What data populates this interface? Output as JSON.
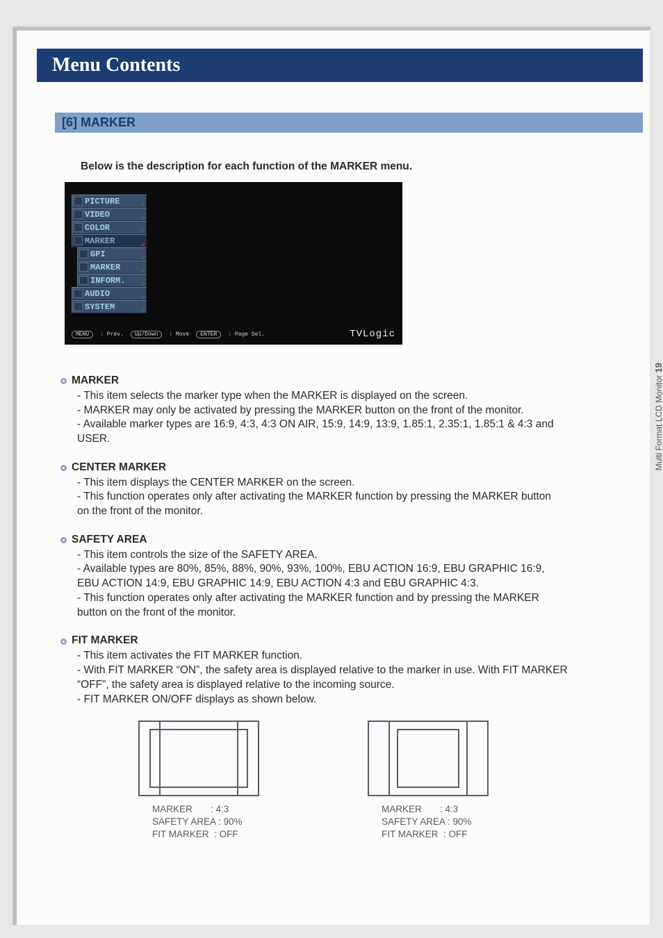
{
  "title": "Menu Contents",
  "section": "[6] MARKER",
  "intro": "Below is the description for each function of the MARKER menu.",
  "tabs": [
    "PICTURE",
    "VIDEO",
    "COLOR",
    "MARKER",
    "GPI",
    "MARKER",
    "INFORM.",
    "AUDIO",
    "SYSTEM"
  ],
  "footer": {
    "menu": "MENU",
    "menu_txt": ": Prev.",
    "updown": "Up/Down",
    "updown_txt": ": Move",
    "enter": "ENTER",
    "enter_txt": ": Page Sel.",
    "brand": "TVLogic"
  },
  "items": [
    {
      "title": "MARKER",
      "lines": [
        "- This item selects the marker type when the MARKER is displayed on the screen.",
        "- MARKER may only be activated by pressing the MARKER button on the front of the monitor.",
        "- Available marker types are 16:9, 4:3, 4:3 ON AIR, 15:9, 14:9, 13:9, 1.85:1, 2.35:1, 1.85:1 & 4:3 and\n  USER."
      ]
    },
    {
      "title": "CENTER MARKER",
      "lines": [
        "- This item displays the CENTER MARKER on the screen.",
        "- This function operates only after activating the MARKER function by pressing the MARKER button\n  on the front of the monitor."
      ]
    },
    {
      "title": "SAFETY AREA",
      "lines": [
        "- This item controls the size of the SAFETY AREA.",
        "- Available types are 80%, 85%, 88%, 90%, 93%, 100%, EBU ACTION 16:9, EBU GRAPHIC 16:9,\n  EBU ACTION 14:9, EBU GRAPHIC 14:9, EBU ACTION 4:3 and EBU GRAPHIC 4:3.",
        "- This function operates only after activating the MARKER function and by pressing the MARKER\n  button on the front of the monitor."
      ]
    },
    {
      "title": "FIT MARKER",
      "lines": [
        "- This item activates the FIT MARKER function.",
        "- With FIT MARKER “ON”, the safety area is displayed relative to the marker in use. With FIT MARKER\n “OFF”, the safety area is displayed relative to the incoming source.",
        "- FIT MARKER ON/OFF displays as shown below."
      ]
    }
  ],
  "dia1": "MARKER       : 4:3\nSAFETY AREA : 90%\nFIT MARKER  : OFF",
  "dia2": "MARKER       : 4:3\nSAFETY AREA : 90%\nFIT MARKER  : OFF",
  "side": "Multi Format LCD Monitor",
  "page_num": "19"
}
